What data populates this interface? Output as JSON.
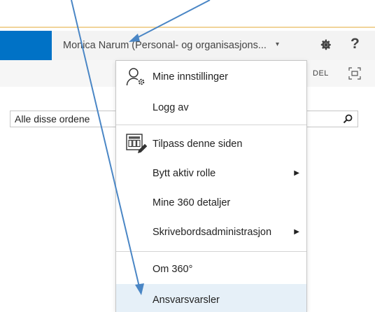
{
  "suite_bar": {
    "user_name": "Monica Narum (Personal- og organisasjons...",
    "caret": "▾",
    "help": "?"
  },
  "sub_bar": {
    "share_label": "DEL"
  },
  "search": {
    "value": "Alle disse ordene"
  },
  "menu": {
    "items": [
      {
        "label": "Mine innstillinger"
      },
      {
        "label": "Logg av"
      },
      {
        "label": "Tilpass denne siden"
      },
      {
        "label": "Bytt aktiv rolle",
        "arrow": "▶"
      },
      {
        "label": "Mine 360 detaljer"
      },
      {
        "label": "Skrivebordsadministrasjon",
        "arrow": "▶"
      },
      {
        "label": "Om 360°"
      },
      {
        "label": "Ansvarsvarsler"
      }
    ]
  },
  "colors": {
    "brand_blue": "#0072c6",
    "highlight": "#e6f0f8",
    "annotation_arrow": "#4a86c5"
  }
}
